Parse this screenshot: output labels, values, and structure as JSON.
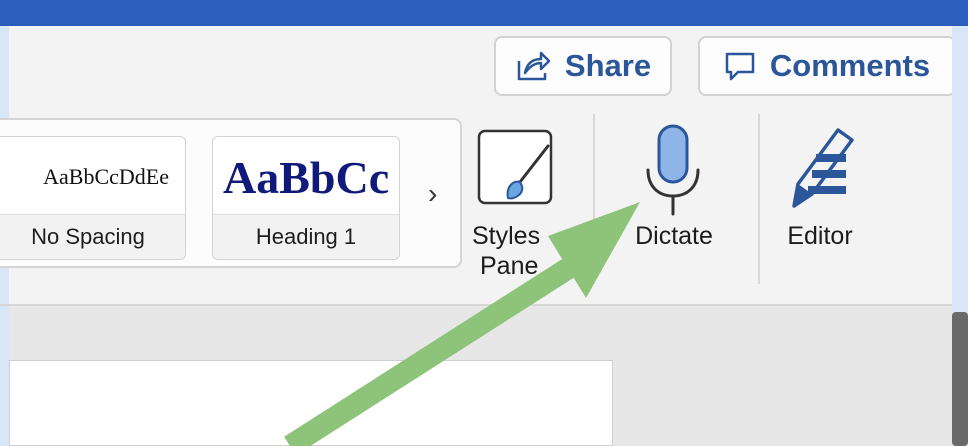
{
  "toolbar": {
    "share_label": "Share",
    "comments_label": "Comments"
  },
  "styles_gallery": {
    "items": [
      {
        "sample": "AaBbCcDdEe",
        "name": "No Spacing"
      },
      {
        "sample": "AaBbCc",
        "name": "Heading 1"
      }
    ],
    "more_glyph": "›"
  },
  "ribbon": {
    "styles_pane_label_line1": "Styles",
    "styles_pane_label_line2": "Pane",
    "dictate_label": "Dictate",
    "editor_label": "Editor"
  },
  "colors": {
    "title_bar": "#2c5fbd",
    "accent": "#2b579a",
    "annotation_arrow": "#8dc47a",
    "mic": "#8fb5e8"
  },
  "icons": [
    "share-icon",
    "comment-icon",
    "styles-pane-icon",
    "microphone-icon",
    "editor-pen-icon",
    "chevron-right-icon"
  ]
}
